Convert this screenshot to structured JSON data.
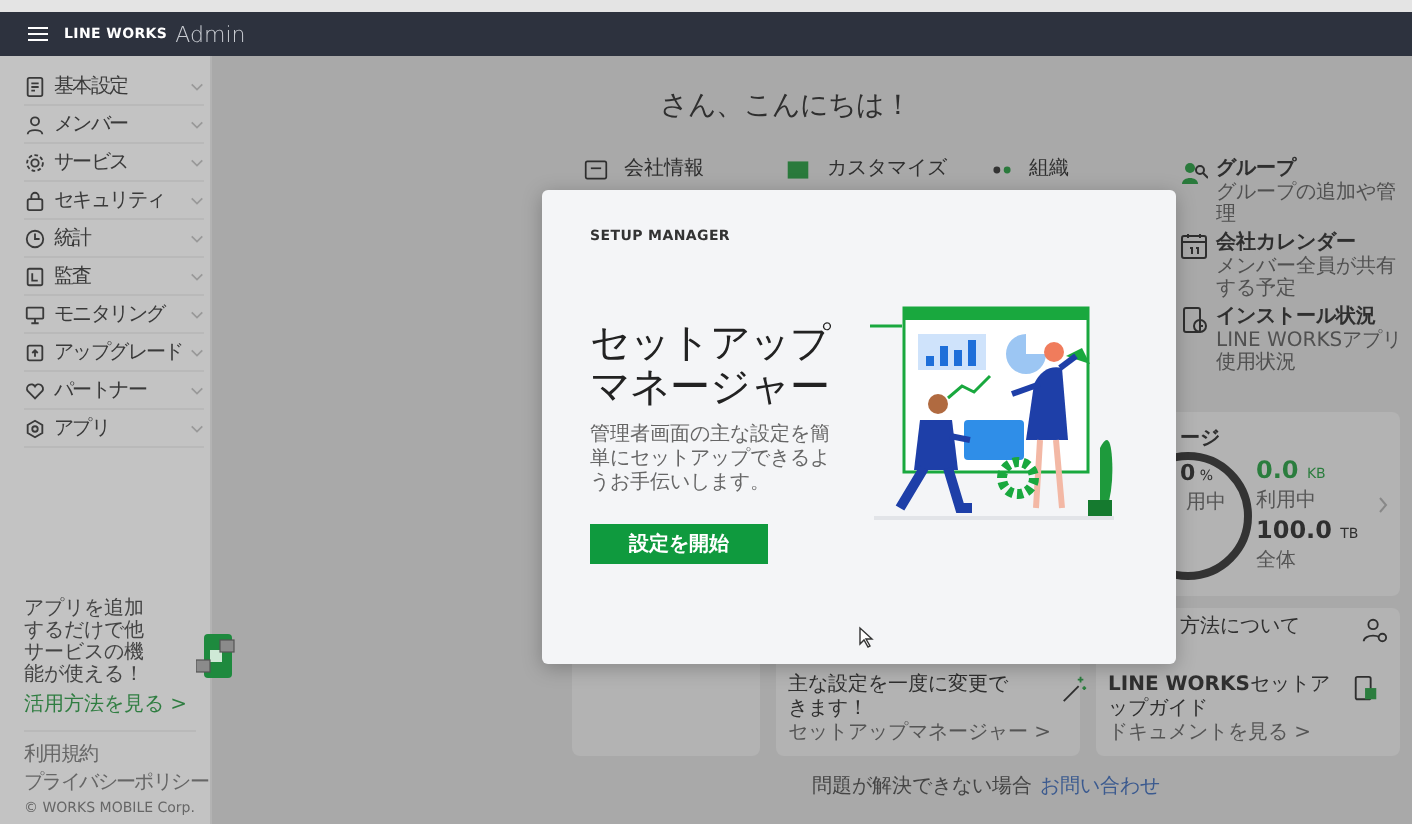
{
  "header": {
    "brand": "LINE WORKS",
    "product": "Admin"
  },
  "sidebar": {
    "items": [
      {
        "label": "基本設定",
        "expanded": false
      },
      {
        "label": "メンバー",
        "expanded": false
      },
      {
        "label": "サービス",
        "expanded": false
      },
      {
        "label": "セキュリティ",
        "expanded": false
      },
      {
        "label": "統計",
        "expanded": false
      },
      {
        "label": "監査",
        "expanded": false
      },
      {
        "label": "モニタリング",
        "expanded": false
      },
      {
        "label": "アップグレード",
        "expanded": false
      },
      {
        "label": "パートナー",
        "expanded": false
      },
      {
        "label": "アプリ",
        "expanded": false
      }
    ],
    "promo": {
      "text": "アプリを追加するだけで他サービスの機能が使える！",
      "link": "活用方法を見る >"
    },
    "links": [
      "利用規約",
      "プライバシーポリシー"
    ],
    "copyright": "© WORKS MOBILE Corp."
  },
  "main": {
    "greeting": "さん、こんにちは！",
    "shortcuts": [
      {
        "title": "会社情報"
      },
      {
        "title": "カスタマイズ"
      },
      {
        "title": "組織"
      }
    ],
    "side_shortcuts": [
      {
        "title": "グループ",
        "subtitle": "グループの追加や管理"
      },
      {
        "title": "会社カレンダー",
        "subtitle": "メンバー全員が共有する予定"
      },
      {
        "title": "インストール状況",
        "subtitle": "LINE WORKSアプリ使用状況"
      }
    ],
    "storage": {
      "title": "ージ",
      "percent": "0",
      "percent_unit": "%",
      "percent_label": "用中",
      "level": 0,
      "used": "0.0",
      "used_unit": "KB",
      "used_label": "利用中",
      "total": "100.0",
      "total_unit": "TB",
      "total_label": "全体"
    },
    "help_cards": [
      {
        "kind": "blank"
      },
      {
        "kind": "items",
        "items": [
          {
            "title": "主な設定を一度に変更できます！",
            "link": "セットアップマネージャー >"
          }
        ]
      },
      {
        "kind": "items",
        "items": [
          {
            "title": "方法について"
          },
          {
            "title": "**LINE WORKS**セットアップガイド",
            "link": "ドキュメントを見る >"
          }
        ]
      }
    ],
    "footer": {
      "text": "問題が解決できない場合",
      "link": "お問い合わせ"
    }
  },
  "modal": {
    "eyebrow": "SETUP MANAGER",
    "title_lines": [
      "セットアップ",
      "マネージャー"
    ],
    "description": "管理者画面の主な設定を簡単にセットアップできるようお手伝いします。",
    "button": "設定を開始"
  }
}
